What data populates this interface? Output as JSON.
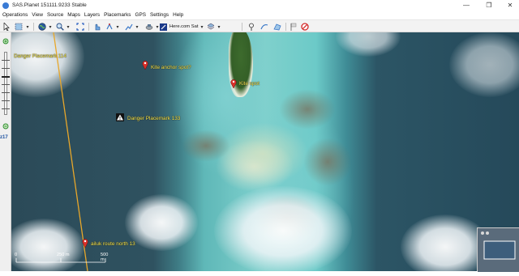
{
  "window": {
    "title": "SAS.Planet 151111.9233 Stable",
    "controls": {
      "minimize": "—",
      "maximize": "❐",
      "close": "✕"
    }
  },
  "menu": [
    "Operations",
    "View",
    "Source",
    "Maps",
    "Layers",
    "Placemarks",
    "GPS",
    "Settings",
    "Help"
  ],
  "toolbar": {
    "map_source_label": "Here.com Sat"
  },
  "map": {
    "zoom_level": "z17",
    "scale": {
      "start": "0",
      "mid": "250 m",
      "end": "500 m"
    },
    "placemarks": [
      {
        "label": "Danger Placemark 114",
        "kind": "warning"
      },
      {
        "label": "Kite anchor spot?",
        "kind": "pin"
      },
      {
        "label": "Kite spot",
        "kind": "pin"
      },
      {
        "label": "Danger Placemark 133",
        "kind": "warning"
      },
      {
        "label": "ailuk route north 13",
        "kind": "pin"
      }
    ]
  },
  "colors": {
    "placemark_label": "#f4e64a",
    "route_line": "#e8a72a",
    "pin_red": "#d9302a"
  }
}
